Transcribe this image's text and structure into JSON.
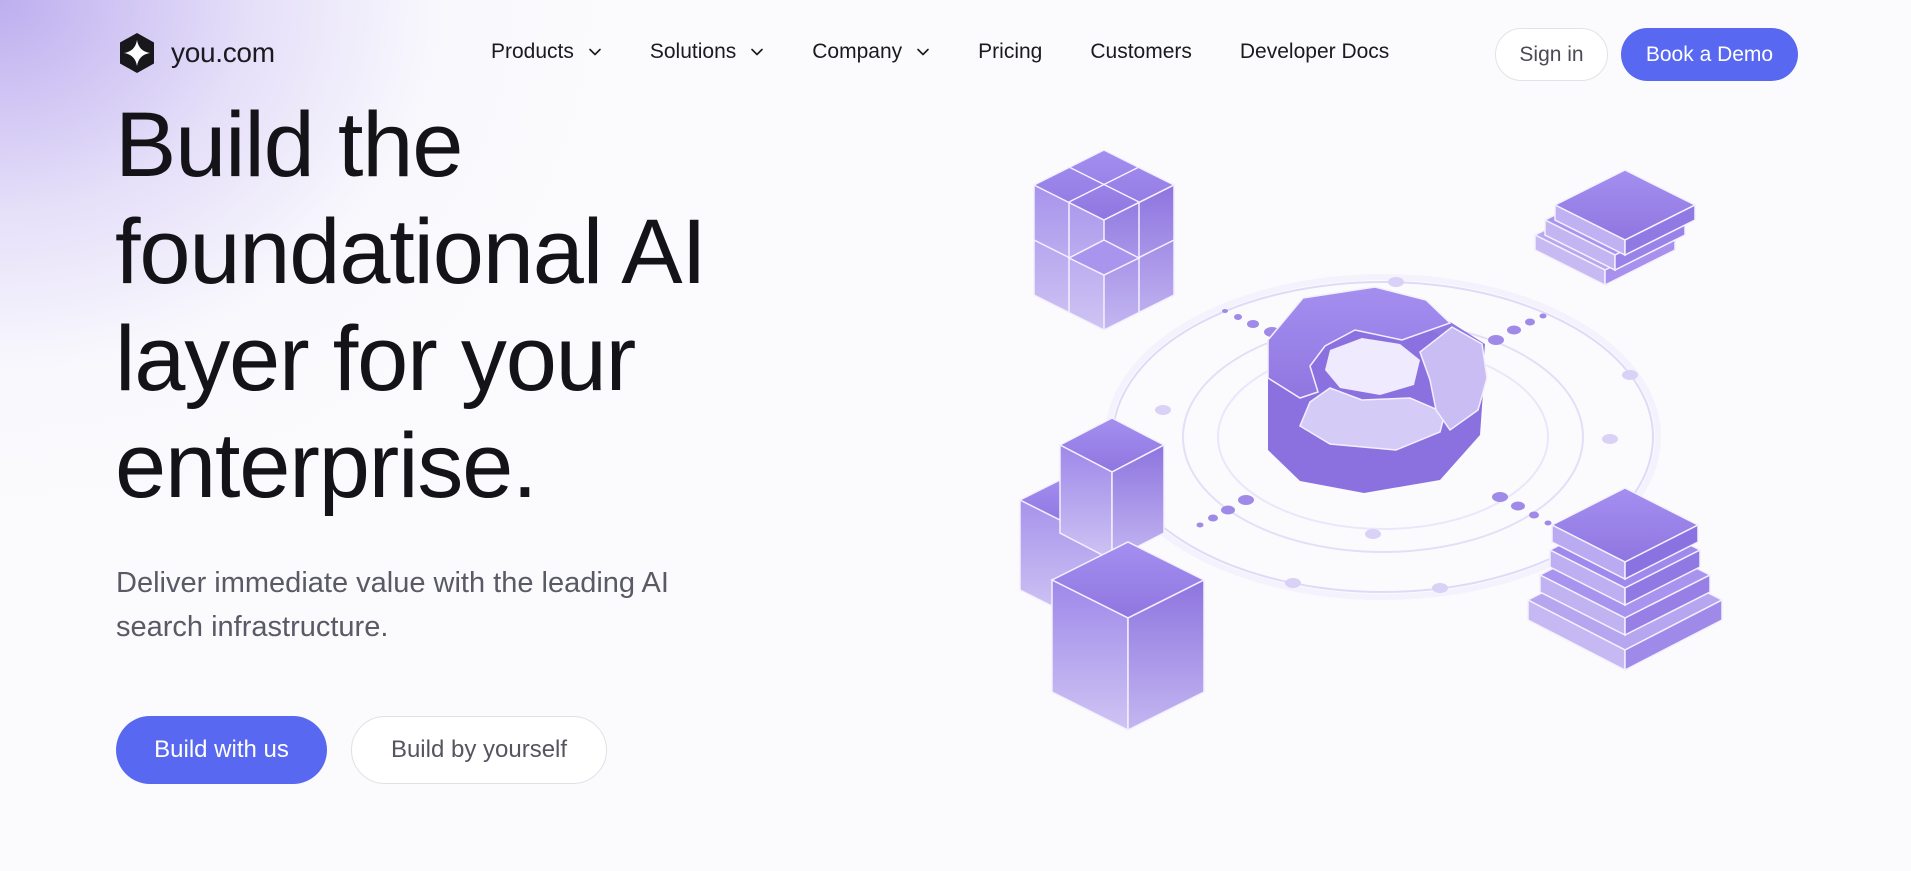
{
  "brand": {
    "name": "you.com",
    "accent": "#5868f0",
    "illustration_color": "#9b86e6"
  },
  "nav": {
    "items": [
      {
        "label": "Products",
        "has_dropdown": true,
        "icon": "chevron-down-icon"
      },
      {
        "label": "Solutions",
        "has_dropdown": true,
        "icon": "chevron-down-icon"
      },
      {
        "label": "Company",
        "has_dropdown": true,
        "icon": "chevron-down-icon"
      },
      {
        "label": "Pricing",
        "has_dropdown": false
      },
      {
        "label": "Customers",
        "has_dropdown": false
      },
      {
        "label": "Developer Docs",
        "has_dropdown": false
      }
    ],
    "sign_in": "Sign in",
    "book_demo": "Book a Demo"
  },
  "hero": {
    "title_lines": [
      "Build the",
      "foundational AI",
      "layer for your",
      "enterprise."
    ],
    "subtitle_lines": [
      "Deliver immediate value with the leading AI",
      "search infrastructure."
    ],
    "cta_primary": "Build with us",
    "cta_secondary": "Build by yourself"
  }
}
